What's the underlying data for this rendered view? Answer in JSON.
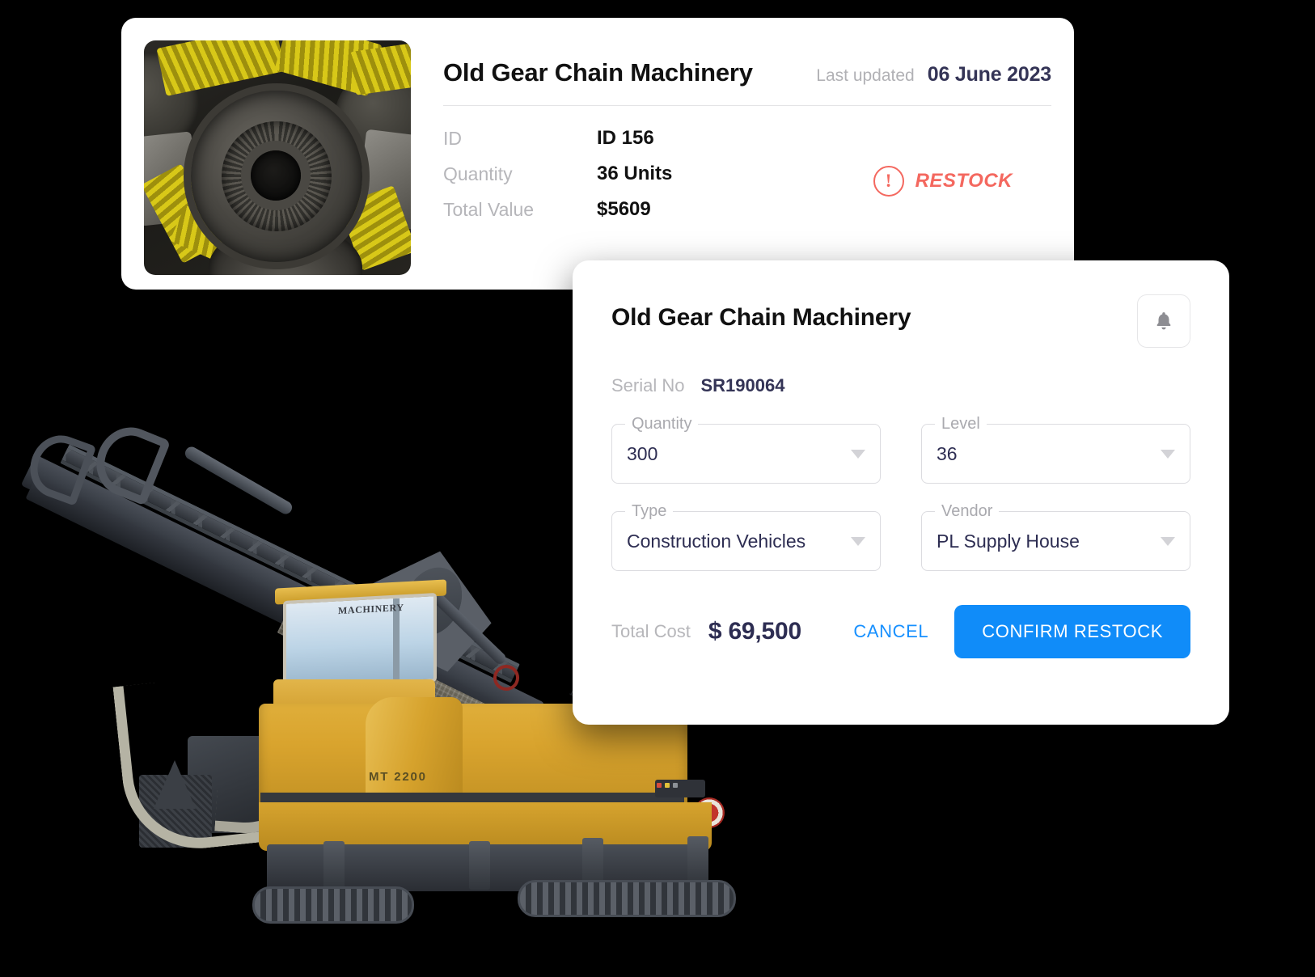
{
  "product_card": {
    "thumbnail_alt": "gear-chain-photo",
    "title": "Old Gear Chain Machinery",
    "last_updated_label": "Last updated",
    "last_updated_value": "06 June 2023",
    "specs": [
      {
        "label": "ID",
        "value": "ID 156"
      },
      {
        "label": "Quantity",
        "value": "36 Units"
      },
      {
        "label": "Total Value",
        "value": "$5609"
      }
    ],
    "status": {
      "icon": "alert-circle-icon",
      "glyph": "!",
      "text": "RESTOCK",
      "color": "#F4685F"
    }
  },
  "restock_modal": {
    "title": "Old Gear Chain Machinery",
    "bell_icon": "bell-icon",
    "serial": {
      "label": "Serial No",
      "value": "SR190064"
    },
    "fields": [
      {
        "label": "Quantity",
        "value": "300",
        "icon": "chevron-down-icon"
      },
      {
        "label": "Level",
        "value": "36",
        "icon": "chevron-down-icon"
      },
      {
        "label": "Type",
        "value": "Construction Vehicles",
        "icon": "chevron-down-icon"
      },
      {
        "label": "Vendor",
        "value": "PL Supply House",
        "icon": "chevron-down-icon"
      }
    ],
    "total_cost_label": "Total Cost",
    "total_cost_value": "$ 69,500",
    "cancel_label": "CANCEL",
    "confirm_label": "CONFIRM RESTOCK",
    "accent_color": "#108CF9"
  },
  "machine_photo": {
    "alt": "cold-milling-machine",
    "body_model": "MT 2200",
    "brand": "MACHINERY",
    "cab_brand": "MACHINERY"
  }
}
